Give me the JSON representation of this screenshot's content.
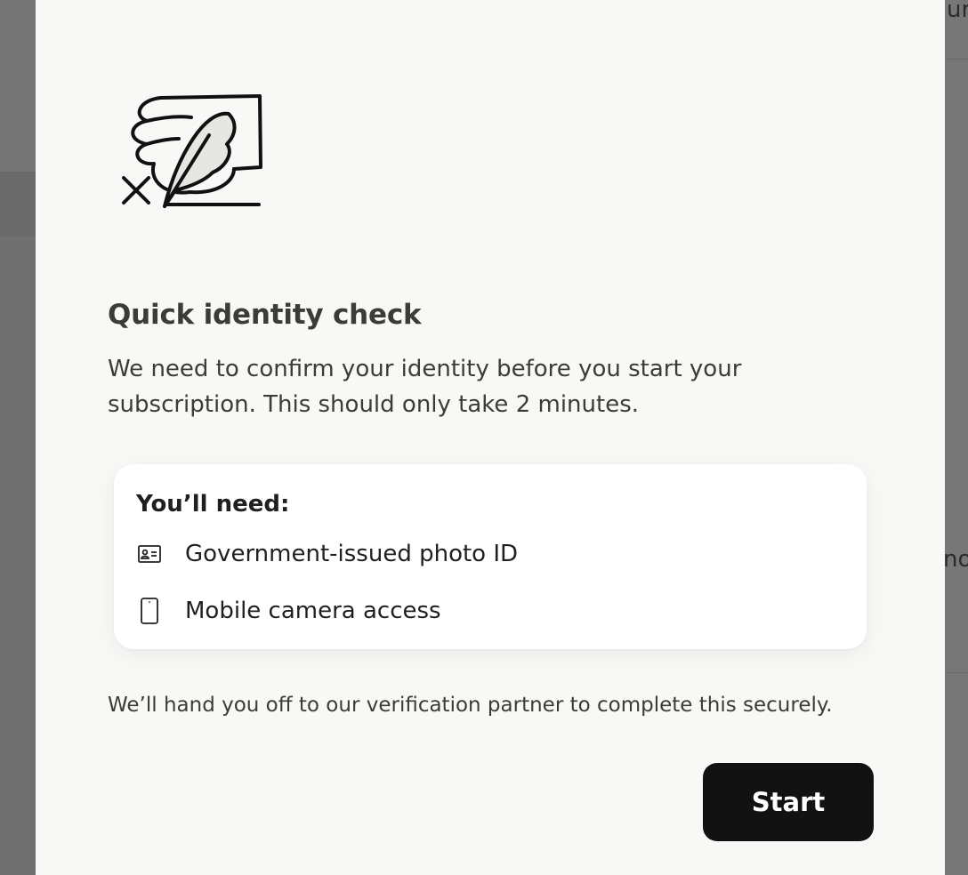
{
  "background": {
    "partial_text_top": "ur s",
    "partial_text_mid": "no"
  },
  "modal": {
    "illustration_icon": "signature-document-icon",
    "title": "Quick identity check",
    "description": "We need to confirm your identity before you start your subscription. This should only take 2 minutes.",
    "requirements": {
      "heading": "You’ll need:",
      "items": [
        {
          "icon": "id-card-icon",
          "label": "Government-issued photo ID"
        },
        {
          "icon": "mobile-phone-icon",
          "label": "Mobile camera access"
        }
      ]
    },
    "footnote": "We’ll hand you off to our verification partner to complete this securely.",
    "start_label": "Start"
  },
  "colors": {
    "overlay": "#6f6f6f",
    "modal_bg": "#f8f8f6",
    "card_bg": "#ffffff",
    "text": "#3b3b38",
    "button_bg": "#121212",
    "button_text": "#ffffff"
  }
}
